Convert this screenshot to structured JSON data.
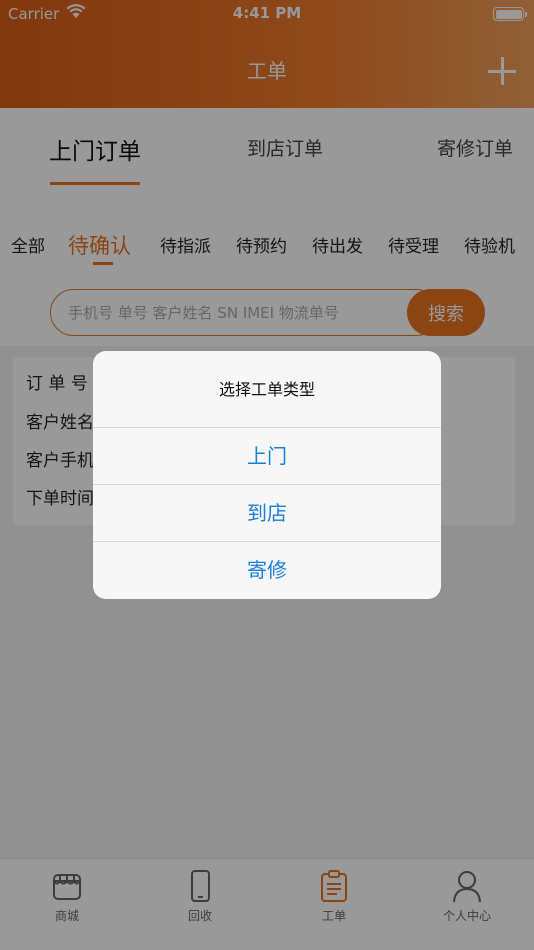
{
  "status_bar": {
    "carrier": "Carrier",
    "time": "4:41 PM"
  },
  "nav": {
    "title": "工单",
    "add_icon": "plus-icon"
  },
  "tabs": [
    {
      "label": "上门订单",
      "active": true
    },
    {
      "label": "到店订单",
      "active": false
    },
    {
      "label": "寄修订单",
      "active": false
    }
  ],
  "filters": [
    {
      "label": "全部",
      "active": false
    },
    {
      "label": "待确认",
      "active": true
    },
    {
      "label": "待指派",
      "active": false
    },
    {
      "label": "待预约",
      "active": false
    },
    {
      "label": "待出发",
      "active": false
    },
    {
      "label": "待受理",
      "active": false
    },
    {
      "label": "待验机",
      "active": false
    }
  ],
  "search": {
    "placeholder": "手机号 单号 客户姓名 SN IMEI 物流单号",
    "button_label": "搜索"
  },
  "order_card": {
    "fields": [
      "订 单 号",
      "客户姓名",
      "客户手机",
      "下单时间"
    ]
  },
  "tabbar": [
    {
      "label": "商城",
      "icon": "store-icon",
      "active": false
    },
    {
      "label": "回收",
      "icon": "phone-icon",
      "active": false
    },
    {
      "label": "工单",
      "icon": "clipboard-icon",
      "active": true
    },
    {
      "label": "个人中心",
      "icon": "user-icon",
      "active": false
    }
  ],
  "action_sheet": {
    "title": "选择工单类型",
    "options": [
      "上门",
      "到店",
      "寄修"
    ]
  },
  "colors": {
    "accent": "#e8731f",
    "link": "#1a7fd9"
  }
}
